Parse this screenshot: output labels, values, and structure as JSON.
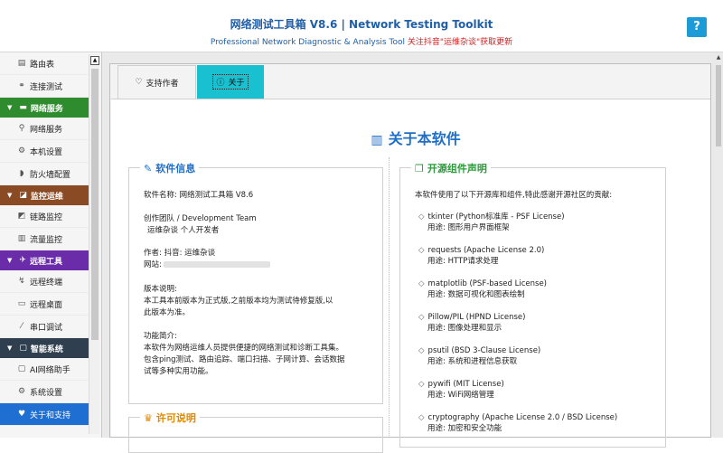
{
  "header": {
    "title": "网络测试工具箱 V8.6 | Network Testing Toolkit",
    "subtitle": "Professional Network Diagnostic & Analysis Tool",
    "promo": "关注抖音\"运维杂谈\"获取更新",
    "help_label": "?"
  },
  "sidebar": {
    "items": [
      {
        "label": "路由表",
        "icon": "routing-table-icon",
        "type": "item"
      },
      {
        "label": "连接测试",
        "icon": "link-icon",
        "type": "item"
      },
      {
        "label": "网络服务",
        "icon": "monitor-icon",
        "type": "group",
        "color": "#2e8b2e"
      },
      {
        "label": "网络服务",
        "icon": "network-icon",
        "type": "item"
      },
      {
        "label": "本机设置",
        "icon": "gear-icon",
        "type": "item"
      },
      {
        "label": "防火墙配置",
        "icon": "shield-icon",
        "type": "item"
      },
      {
        "label": "监控运维",
        "icon": "chart-icon",
        "type": "group",
        "color": "#8a4a24"
      },
      {
        "label": "链路监控",
        "icon": "link-monitor-icon",
        "type": "item"
      },
      {
        "label": "流量监控",
        "icon": "bar-chart-icon",
        "type": "item"
      },
      {
        "label": "远程工具",
        "icon": "remote-icon",
        "type": "group",
        "color": "#6a2ca8"
      },
      {
        "label": "远程终端",
        "icon": "terminal-icon",
        "type": "item"
      },
      {
        "label": "远程桌面",
        "icon": "desktop-icon",
        "type": "item"
      },
      {
        "label": "串口调试",
        "icon": "serial-icon",
        "type": "item"
      },
      {
        "label": "智能系统",
        "icon": "chat-icon",
        "type": "group",
        "color": "#2f3f4f"
      },
      {
        "label": "AI网络助手",
        "icon": "ai-chat-icon",
        "type": "item"
      },
      {
        "label": "系统设置",
        "icon": "settings-icon",
        "type": "item"
      },
      {
        "label": "关于和支持",
        "icon": "heart-icon",
        "type": "item",
        "active": true
      }
    ]
  },
  "tabs": {
    "support": "支持作者",
    "about": "关于"
  },
  "about": {
    "title": "关于本软件",
    "info": {
      "legend": "软件信息",
      "name": "软件名称: 网络测试工具箱 V8.6",
      "team_line1": "创作团队 / Development Team",
      "team_line2": "运维杂谈  个人开发者",
      "author": "作者: 抖音: 运维杂谈",
      "website": "网站:",
      "version_title": "版本说明:",
      "version_line1": "本工具本前版本为正式版,之前版本均为测试待修复版,以",
      "version_line2": "此版本为准。",
      "intro_title": "功能简介:",
      "intro_line1": "本软件为网络运维人员提供便捷的网络测试和诊断工具集。",
      "intro_line2": "包含ping测试、路由追踪、端口扫描、子网计算、会话数据",
      "intro_line3": "试等多种实用功能。"
    },
    "license_legend": "许可说明",
    "open_source": {
      "legend": "开源组件声明",
      "intro": "本软件使用了以下开源库和组件,特此感谢开源社区的贡献:",
      "components": [
        {
          "name": "tkinter (Python标准库 - PSF License)",
          "use": "用途: 图形用户界面框架"
        },
        {
          "name": "requests (Apache License 2.0)",
          "use": "用途: HTTP请求处理"
        },
        {
          "name": "matplotlib (PSF-based License)",
          "use": "用途: 数据可视化和图表绘制"
        },
        {
          "name": "Pillow/PIL (HPND License)",
          "use": "用途: 图像处理和显示"
        },
        {
          "name": "psutil (BSD 3-Clause License)",
          "use": "用途: 系统和进程信息获取"
        },
        {
          "name": "pywifi (MIT License)",
          "use": "用途: WiFi网络管理"
        },
        {
          "name": "cryptography (Apache License 2.0 / BSD License)",
          "use": "用途: 加密和安全功能"
        }
      ]
    }
  }
}
